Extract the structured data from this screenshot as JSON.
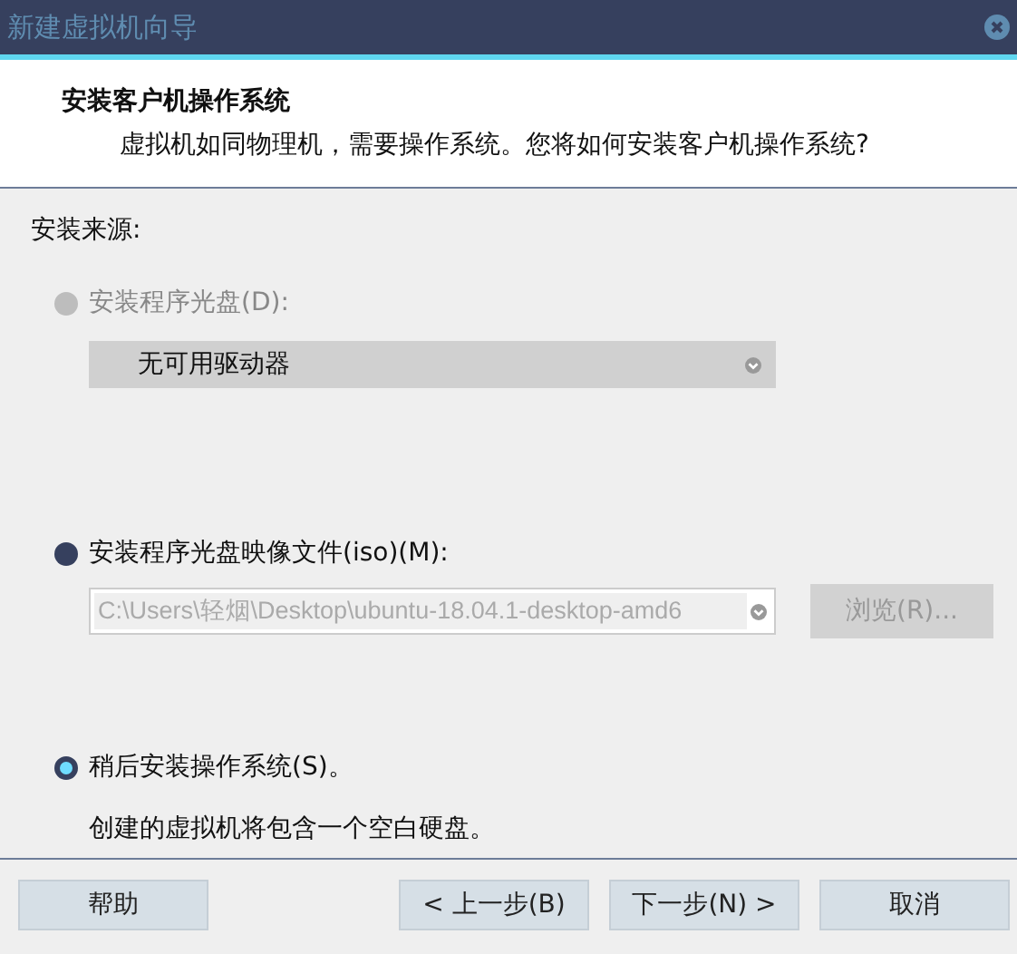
{
  "window": {
    "title": "新建虚拟机向导"
  },
  "header": {
    "title": "安装客户机操作系统",
    "subtitle": "虚拟机如同物理机，需要操作系统。您将如何安装客户机操作系统?"
  },
  "section_label": "安装来源:",
  "options": [
    {
      "kind": "disc",
      "label": "安装程序光盘(D):",
      "selected": false,
      "disabled": true,
      "dropdown": {
        "value": "无可用驱动器",
        "disabled": true
      }
    },
    {
      "kind": "iso",
      "label": "安装程序光盘映像文件(iso)(M):",
      "selected": false,
      "disabled": false,
      "path_field": {
        "value": "C:\\Users\\轻烟\\Desktop\\ubuntu-18.04.1-desktop-amd6",
        "disabled": true
      },
      "browse_button": {
        "label": "浏览(R)...",
        "disabled": true
      }
    },
    {
      "kind": "later",
      "label": "稍后安装操作系统(S)。",
      "selected": true,
      "disabled": false,
      "description": "创建的虚拟机将包含一个空白硬盘。"
    }
  ],
  "buttons": [
    {
      "label": "帮助"
    },
    {
      "label": "< 上一步(B)"
    },
    {
      "label": "下一步(N) >"
    },
    {
      "label": "取消"
    }
  ]
}
